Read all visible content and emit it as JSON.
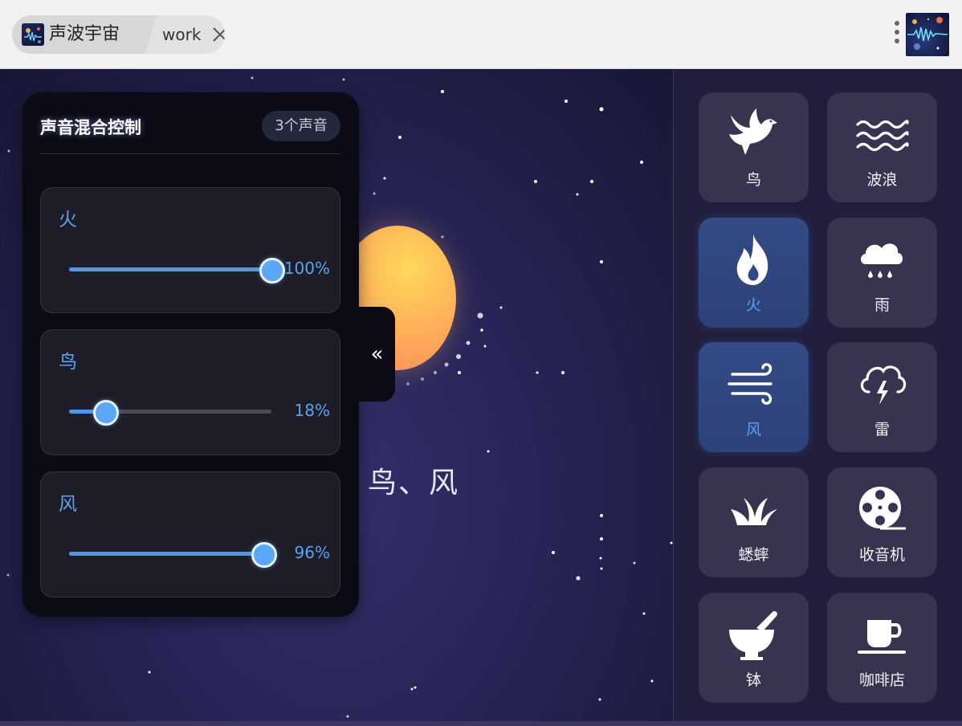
{
  "browser": {
    "tab_title": "声波宇宙",
    "tab_label": "work"
  },
  "scene": {
    "active_label": "鸟、风"
  },
  "mixer": {
    "title": "声音混合控制",
    "count": "3个声音",
    "collapse_symbol": "«",
    "tracks": [
      {
        "name": "火",
        "level": 1.0,
        "percent": "100%"
      },
      {
        "name": "鸟",
        "level": 0.18,
        "percent": "18%"
      },
      {
        "name": "风",
        "level": 0.96,
        "percent": "96%"
      }
    ]
  },
  "sounds": [
    {
      "label": "鸟",
      "icon": "dove-icon",
      "active": true
    },
    {
      "label": "波浪",
      "icon": "waves-icon",
      "active": false
    },
    {
      "label": "火",
      "icon": "fire-icon",
      "active": true
    },
    {
      "label": "雨",
      "icon": "rain-cloud-icon",
      "active": false
    },
    {
      "label": "风",
      "icon": "wind-icon",
      "active": true
    },
    {
      "label": "雷",
      "icon": "thunder-cloud-icon",
      "active": false
    },
    {
      "label": "蟋蟀",
      "icon": "grass-icon",
      "active": false
    },
    {
      "label": "收音机",
      "icon": "film-reel-icon",
      "active": false
    },
    {
      "label": "钵",
      "icon": "mortar-pestle-icon",
      "active": false
    },
    {
      "label": "咖啡店",
      "icon": "coffee-cup-icon",
      "active": false
    }
  ],
  "colors": {
    "accent": "#5aa2f2",
    "active_tile": "#334a85",
    "inactive_tile": "#37344f",
    "panel": "#0c0a14"
  }
}
